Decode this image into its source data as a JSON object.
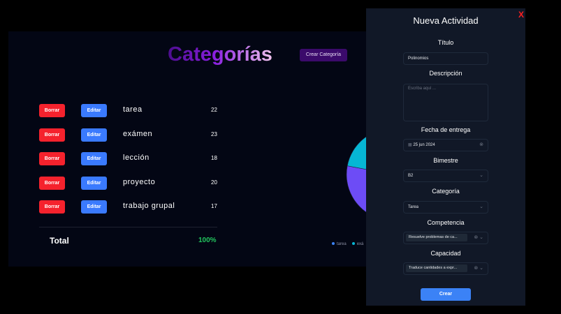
{
  "page": {
    "title": "Categorías",
    "create_button": "Crear Categoría",
    "total_label": "Total",
    "total_value": "100%"
  },
  "categories": [
    {
      "name": "tarea",
      "count": "22"
    },
    {
      "name": "exámen",
      "count": "23"
    },
    {
      "name": "lección",
      "count": "18"
    },
    {
      "name": "proyecto",
      "count": "20"
    },
    {
      "name": "trabajo grupal",
      "count": "17"
    }
  ],
  "row_buttons": {
    "delete": "Borrar",
    "edit": "Editar"
  },
  "chart_data": {
    "type": "pie",
    "categories": [
      "tarea",
      "exámen",
      "lección",
      "proyecto",
      "trabajo grupal"
    ],
    "values": [
      22,
      23,
      18,
      20,
      17
    ],
    "colors": [
      "#6d4cf6",
      "#06b6d4",
      "#22c55e",
      "#f59e0b",
      "#a83cf5"
    ],
    "legend_visible": [
      "tarea",
      "exá"
    ]
  },
  "modal": {
    "title": "Nueva Actividad",
    "close": "X",
    "titulo_label": "Título",
    "titulo_value": "Polinomios",
    "descripcion_label": "Descripción",
    "descripcion_placeholder": "Escriba aquí ...",
    "fecha_label": "Fecha de entrega",
    "fecha_value": "25 jun 2024",
    "bimestre_label": "Bimestre",
    "bimestre_value": "B2",
    "categoria_label": "Categoría",
    "categoria_value": "Tarea",
    "competencia_label": "Competencia",
    "competencia_value": "Resuelve problemas de ca...",
    "capacidad_label": "Capacidad",
    "capacidad_value": "Traduce cantidades a expr...",
    "submit": "Crear"
  }
}
